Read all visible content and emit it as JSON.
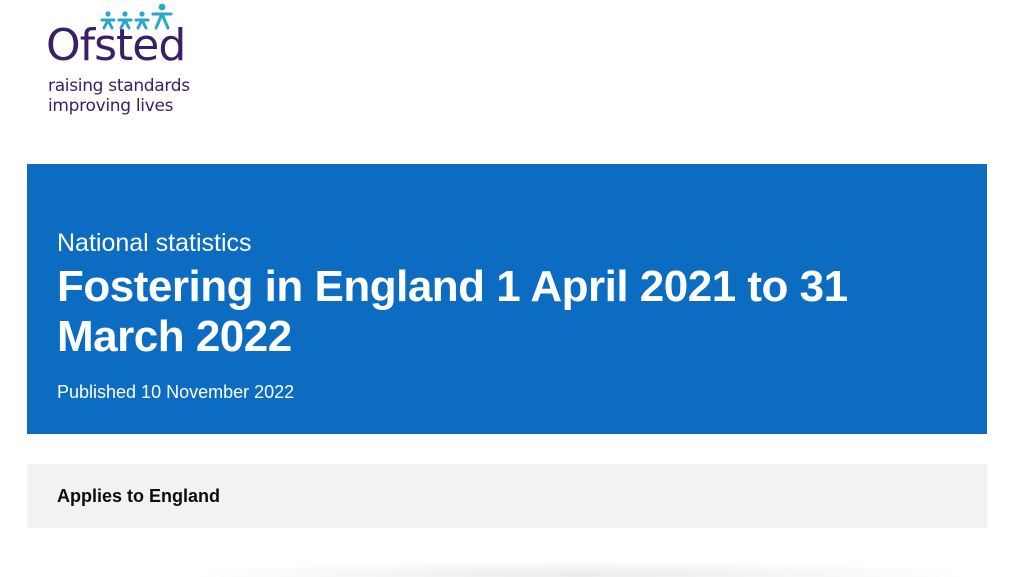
{
  "logo": {
    "name": "Ofsted",
    "tagline_line1": "raising standards",
    "tagline_line2": "improving lives",
    "icon": "people-figures-icon",
    "colors": {
      "text": "#3b1e63",
      "figures": "#2aa7c9"
    }
  },
  "hero": {
    "kicker": "National statistics",
    "title": "Fostering in England 1 April 2021 to 31 March 2022",
    "published": "Published 10 November 2022",
    "background": "#0b6cc2"
  },
  "applies": {
    "text": "Applies to England",
    "background": "#f3f2f1"
  }
}
